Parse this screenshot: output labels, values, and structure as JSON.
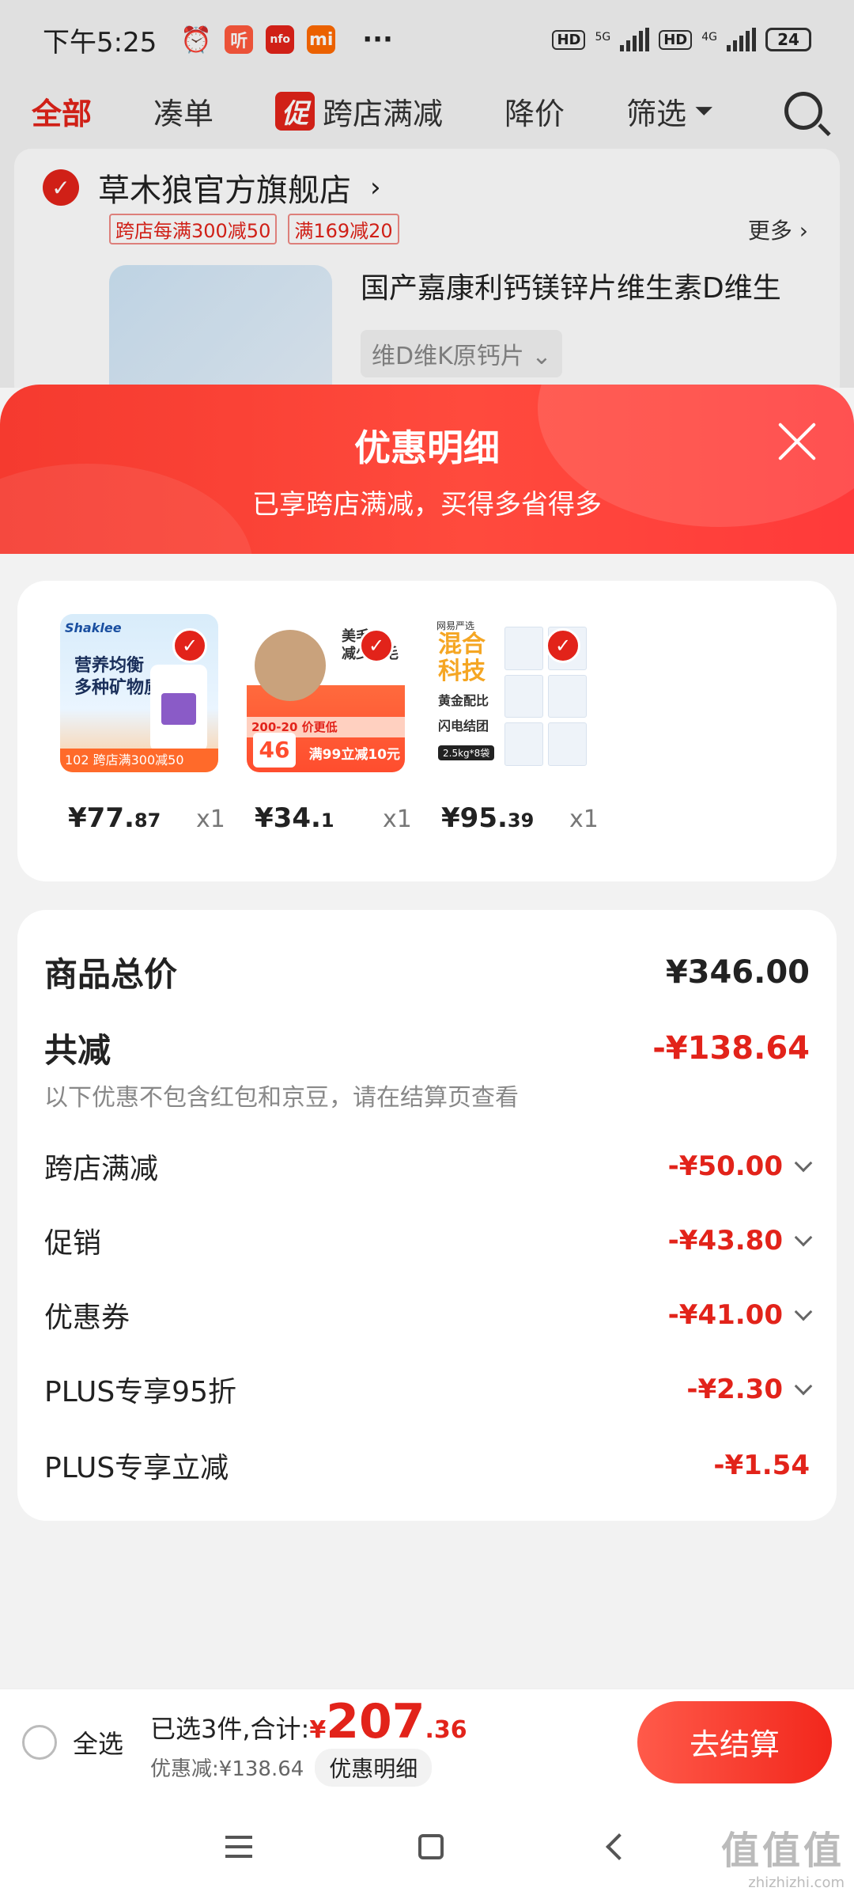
{
  "status_bar": {
    "time": "下午5:25",
    "app_icons": [
      "alarm-icon",
      "听",
      "nfo",
      "mi"
    ],
    "more": "···",
    "net1": "5G",
    "net2": "4G",
    "battery": "24"
  },
  "filter_tabs": {
    "all": "全部",
    "combine": "凑单",
    "promo_tag": "促",
    "cross_store": "跨店满减",
    "price_drop": "降价",
    "filter": "筛选"
  },
  "shop": {
    "name": "草木狼官方旗舰店",
    "tags": [
      "跨店每满300减50",
      "满169减20"
    ],
    "more": "更多",
    "item_title": "国产嘉康利钙镁锌片维生素D维生",
    "item_spec": "维D维K原钙片"
  },
  "sheet": {
    "title": "优惠明细",
    "subtitle": "已享跨店满减，买得多省得多"
  },
  "products": [
    {
      "price_int": "¥77.",
      "price_dec": "87",
      "qty": "x1",
      "img": {
        "brand": "Shaklee",
        "line1": "营养均衡",
        "line2": "多种矿物质",
        "bottom": "102 跨店满300减50"
      }
    },
    {
      "price_int": "¥34.",
      "price_dec": "1",
      "qty": "x1",
      "img": {
        "line1": "美毛",
        "line2": "减少掉毛",
        "strip": "200-20 价更低",
        "num": "46",
        "promo": "满99立减10元"
      }
    },
    {
      "price_int": "¥95.",
      "price_dec": "39",
      "qty": "x1",
      "img": {
        "header": "网易严选",
        "big1": "混合",
        "big2": "科技",
        "gold": "黄金配比",
        "flash": "闪电结团",
        "kg": "2.5kg*8袋"
      }
    }
  ],
  "summary": {
    "total_label": "商品总价",
    "total_value": "¥346.00",
    "reduce_label": "共减",
    "reduce_value": "-¥138.64",
    "note": "以下优惠不包含红包和京豆，请在结算页查看",
    "items": [
      {
        "label": "跨店满减",
        "value": "-¥50.00"
      },
      {
        "label": "促销",
        "value": "-¥43.80"
      },
      {
        "label": "优惠券",
        "value": "-¥41.00"
      },
      {
        "label": "PLUS专享95折",
        "value": "-¥2.30"
      },
      {
        "label": "PLUS专享立减",
        "value": "-¥1.54"
      }
    ]
  },
  "bottom_bar": {
    "select_all": "全选",
    "selected_text": "已选3件,合计:",
    "yen": "¥",
    "total_int": "207",
    "total_dec": ".36",
    "discount_text": "优惠减:¥138.64",
    "detail_button": "优惠明细",
    "checkout": "去结算"
  },
  "watermark": {
    "line1": "值值值",
    "line2": "zhizhizhi.com"
  },
  "colors": {
    "accent": "#e2231a",
    "sheet_header": "#ff4a3d"
  }
}
